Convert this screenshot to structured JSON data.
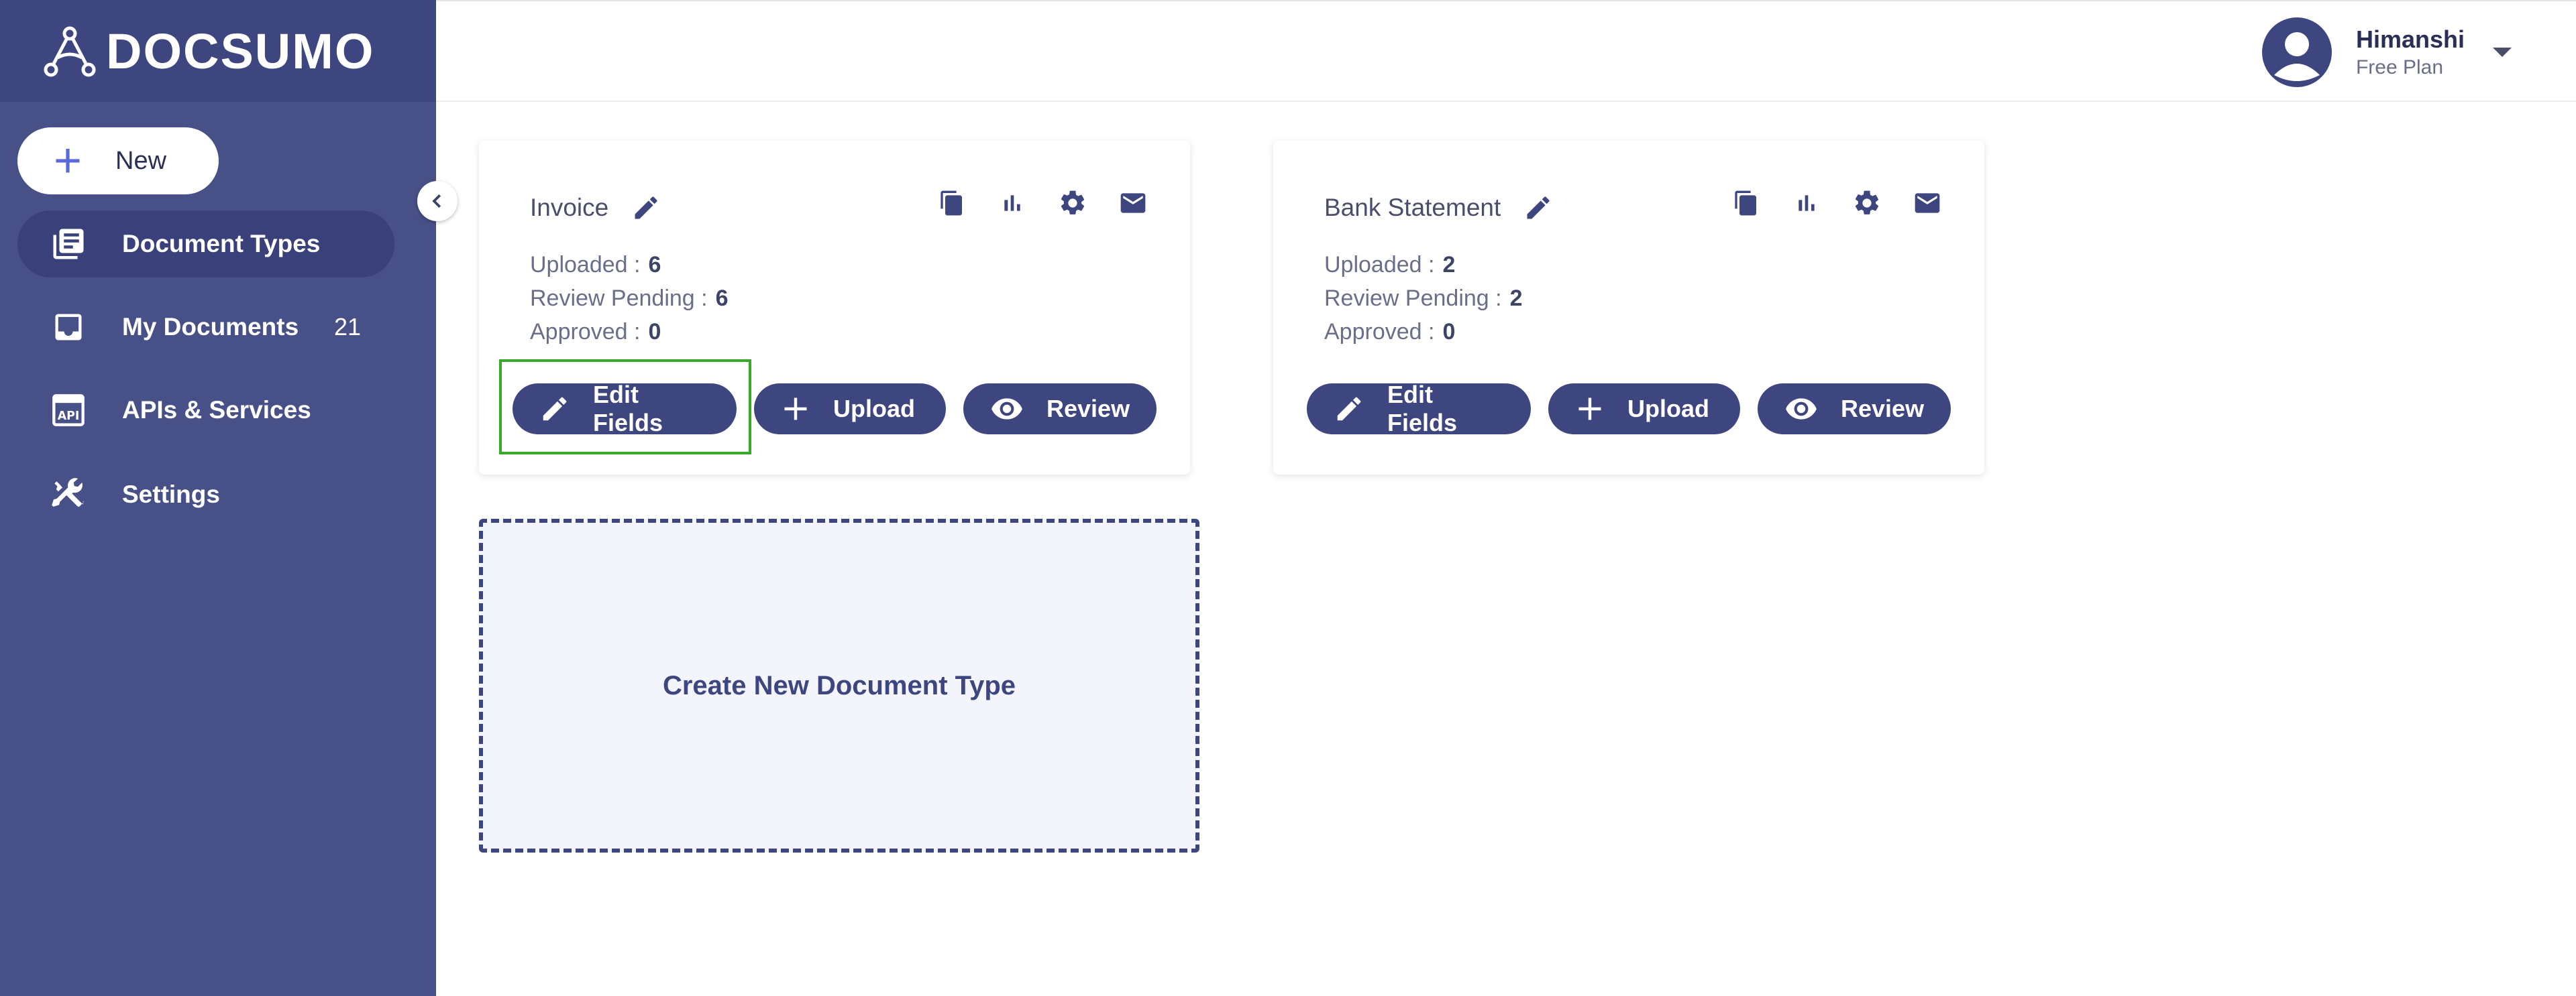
{
  "brand": {
    "name": "DOCSUMO",
    "logo_icon": "docsumo-logo-icon"
  },
  "sidebar": {
    "new_label": "New",
    "items": [
      {
        "label": "Document Types",
        "icon": "document-types-icon",
        "active": true
      },
      {
        "label": "My Documents",
        "icon": "inbox-icon",
        "count": "21"
      },
      {
        "label": "APIs & Services",
        "icon": "api-icon"
      },
      {
        "label": "Settings",
        "icon": "wrench-screwdriver-icon"
      }
    ]
  },
  "user": {
    "name": "Himanshi",
    "plan": "Free Plan"
  },
  "cards": [
    {
      "title": "Invoice",
      "uploaded_label": "Uploaded :",
      "uploaded": "6",
      "pending_label": "Review Pending :",
      "pending": "6",
      "approved_label": "Approved :",
      "approved": "0",
      "edit_label": "Edit Fields",
      "upload_label": "Upload",
      "review_label": "Review"
    },
    {
      "title": "Bank Statement",
      "uploaded_label": "Uploaded :",
      "uploaded": "2",
      "pending_label": "Review Pending :",
      "pending": "2",
      "approved_label": "Approved :",
      "approved": "0",
      "edit_label": "Edit Fields",
      "upload_label": "Upload",
      "review_label": "Review"
    }
  ],
  "create_label": "Create New Document Type",
  "colors": {
    "sidebar": "#485088",
    "accent": "#3e4680",
    "highlight": "#3aa82a"
  }
}
